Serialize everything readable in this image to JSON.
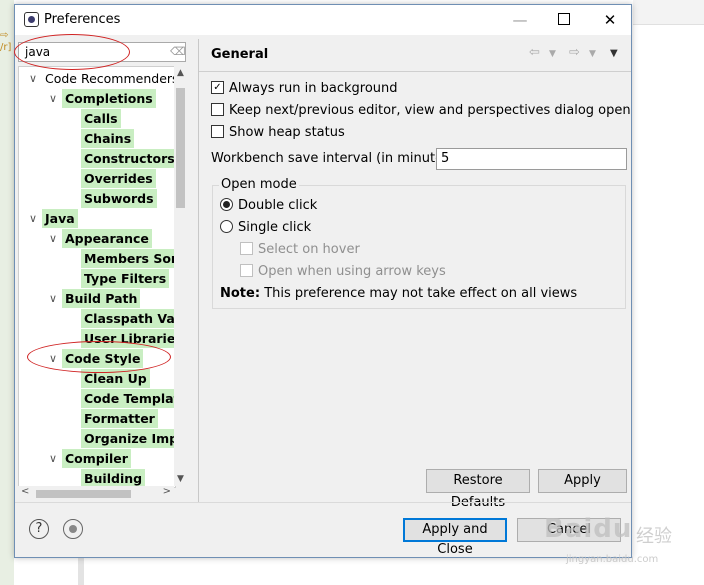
{
  "window": {
    "title": "Preferences"
  },
  "filter": {
    "value": "java"
  },
  "tree": {
    "items": [
      {
        "label": "Code Recommenders",
        "level": 0,
        "expanded": true,
        "highlight": false
      },
      {
        "label": "Completions",
        "level": 1,
        "expanded": true,
        "highlight": true
      },
      {
        "label": "Calls",
        "level": 2,
        "expanded": null,
        "highlight": true
      },
      {
        "label": "Chains",
        "level": 2,
        "expanded": null,
        "highlight": true
      },
      {
        "label": "Constructors",
        "level": 2,
        "expanded": null,
        "highlight": true
      },
      {
        "label": "Overrides",
        "level": 2,
        "expanded": null,
        "highlight": true
      },
      {
        "label": "Subwords",
        "level": 2,
        "expanded": null,
        "highlight": true
      },
      {
        "label": "Java",
        "level": 0,
        "expanded": true,
        "highlight": true
      },
      {
        "label": "Appearance",
        "level": 1,
        "expanded": true,
        "highlight": true
      },
      {
        "label": "Members Sort",
        "level": 2,
        "expanded": null,
        "highlight": true
      },
      {
        "label": "Type Filters",
        "level": 2,
        "expanded": null,
        "highlight": true
      },
      {
        "label": "Build Path",
        "level": 1,
        "expanded": true,
        "highlight": true
      },
      {
        "label": "Classpath Vari",
        "level": 2,
        "expanded": null,
        "highlight": true
      },
      {
        "label": "User Libraries",
        "level": 2,
        "expanded": null,
        "highlight": true
      },
      {
        "label": "Code Style",
        "level": 1,
        "expanded": true,
        "highlight": true
      },
      {
        "label": "Clean Up",
        "level": 2,
        "expanded": null,
        "highlight": true
      },
      {
        "label": "Code Templat",
        "level": 2,
        "expanded": null,
        "highlight": true
      },
      {
        "label": "Formatter",
        "level": 2,
        "expanded": null,
        "highlight": true
      },
      {
        "label": "Organize Impo",
        "level": 2,
        "expanded": null,
        "highlight": true
      },
      {
        "label": "Compiler",
        "level": 1,
        "expanded": true,
        "highlight": true
      },
      {
        "label": "Building",
        "level": 2,
        "expanded": null,
        "highlight": true
      }
    ]
  },
  "page": {
    "title": "General",
    "always_run_bg": {
      "label": "Always run in background",
      "checked": true
    },
    "keep_next_prev": {
      "label": "Keep next/previous editor, view and perspectives dialog open",
      "checked": false
    },
    "show_heap": {
      "label": "Show heap status",
      "checked": false
    },
    "save_interval": {
      "label": "Workbench save interval (in minutes):",
      "value": "5"
    },
    "open_mode": {
      "label": "Open mode",
      "double_click": "Double click",
      "single_click": "Single click",
      "selected": "Double click",
      "select_on_hover": "Select on hover",
      "open_arrow_keys": "Open when using arrow keys"
    },
    "note_label": "Note:",
    "note_text": "This preference may not take effect on all views",
    "restore_defaults": "Restore Defaults",
    "apply": "Apply"
  },
  "footer": {
    "apply_close": "Apply and Close",
    "cancel": "Cancel"
  },
  "watermark": {
    "brand": "Baidu",
    "brand_cn": "经验",
    "url": "jingyan.baidu.com"
  },
  "colors": {
    "highlight": "#c9eec2",
    "annotation": "#d02424",
    "focus": "#0078d7"
  }
}
